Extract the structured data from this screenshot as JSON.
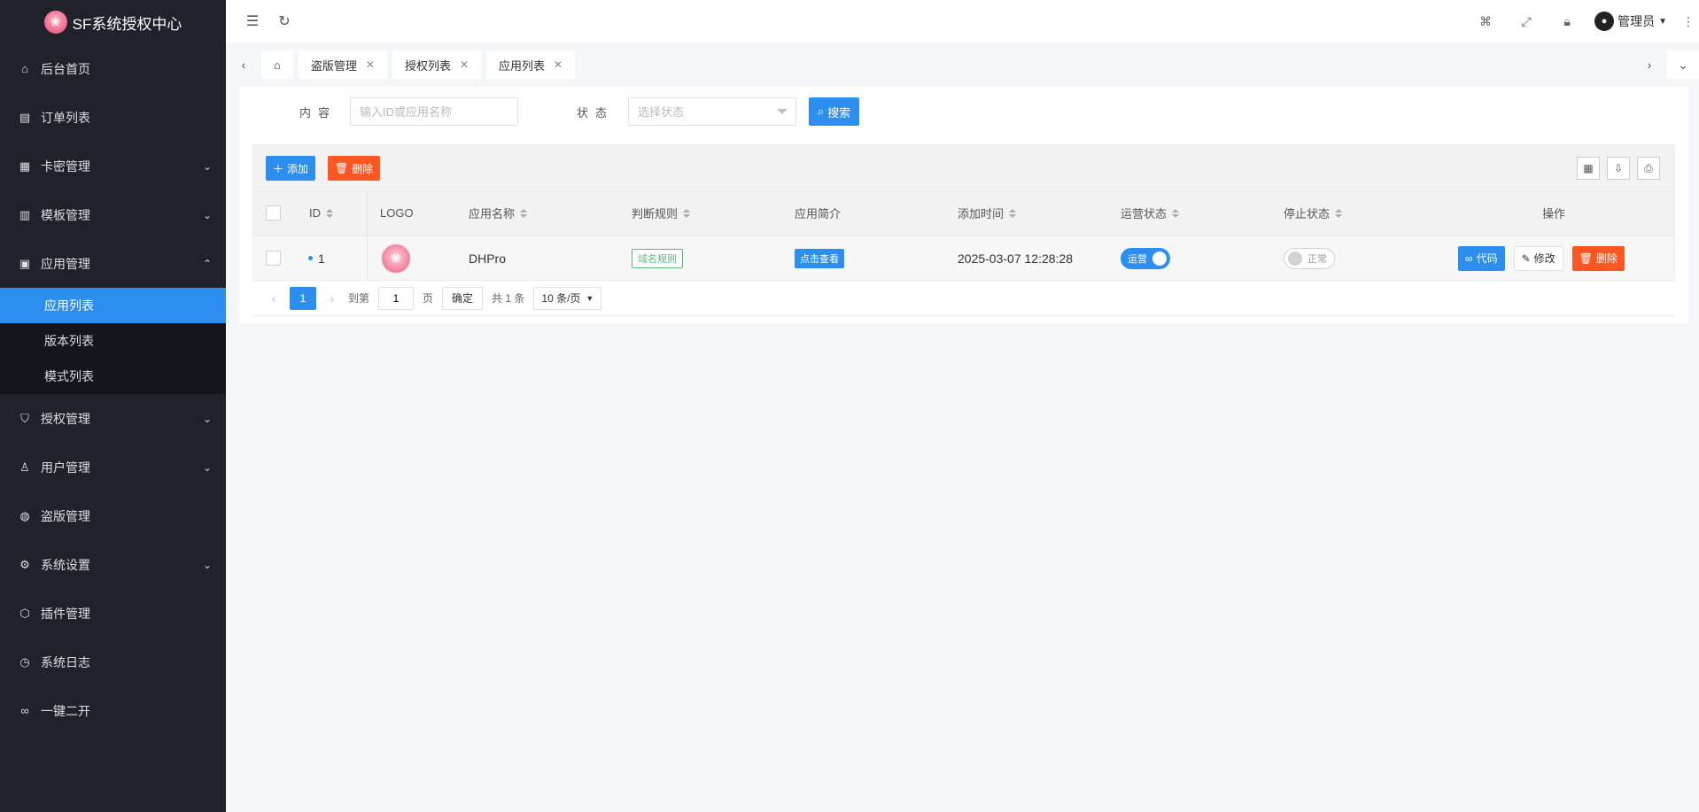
{
  "brand": {
    "title": "SF系统授权中心"
  },
  "sidebar": {
    "items": [
      {
        "label": "后台首页",
        "icon": "home-icon"
      },
      {
        "label": "订单列表",
        "icon": "document-icon"
      },
      {
        "label": "卡密管理",
        "icon": "grid-icon"
      },
      {
        "label": "模板管理",
        "icon": "template-icon"
      },
      {
        "label": "应用管理",
        "icon": "apps-icon"
      },
      {
        "label": "授权管理",
        "icon": "shield-icon"
      },
      {
        "label": "用户管理",
        "icon": "user-icon"
      },
      {
        "label": "盗版管理",
        "icon": "globe-icon"
      },
      {
        "label": "系统设置",
        "icon": "gear-icon"
      },
      {
        "label": "插件管理",
        "icon": "cube-icon"
      },
      {
        "label": "系统日志",
        "icon": "clock-icon"
      },
      {
        "label": "一键二开",
        "icon": "link-icon"
      }
    ],
    "subitems": [
      {
        "label": "应用列表"
      },
      {
        "label": "版本列表"
      },
      {
        "label": "模式列表"
      }
    ]
  },
  "header": {
    "admin_name": "管理员"
  },
  "tabs": [
    {
      "label": "盗版管理"
    },
    {
      "label": "授权列表"
    },
    {
      "label": "应用列表"
    }
  ],
  "search": {
    "content_label": "内容",
    "content_placeholder": "输入ID或应用名称",
    "status_label": "状态",
    "status_placeholder": "选择状态",
    "search_button": "搜索"
  },
  "toolbar": {
    "add_label": "添加",
    "delete_label": "删除"
  },
  "table": {
    "columns": [
      "ID",
      "LOGO",
      "应用名称",
      "判断规则",
      "应用简介",
      "添加时间",
      "运营状态",
      "停止状态",
      "操作"
    ],
    "rows": [
      {
        "id": "1",
        "name": "DHPro",
        "rule": "域名规则",
        "intro": "点击查看",
        "added": "2025-03-07 12:28:28",
        "operate_status": "运营",
        "stop_status": "正常",
        "actions": {
          "code": "代码",
          "edit": "修改",
          "delete": "删除"
        }
      }
    ]
  },
  "pager": {
    "current": "1",
    "goto_label": "到第",
    "goto_value": "1",
    "page_unit": "页",
    "confirm": "确定",
    "total": "共 1 条",
    "page_size": "10 条/页"
  },
  "colors": {
    "sidebar_bg": "#20222a",
    "primary": "#2c8ff0",
    "danger": "#ff5722",
    "success": "#5fb878"
  }
}
